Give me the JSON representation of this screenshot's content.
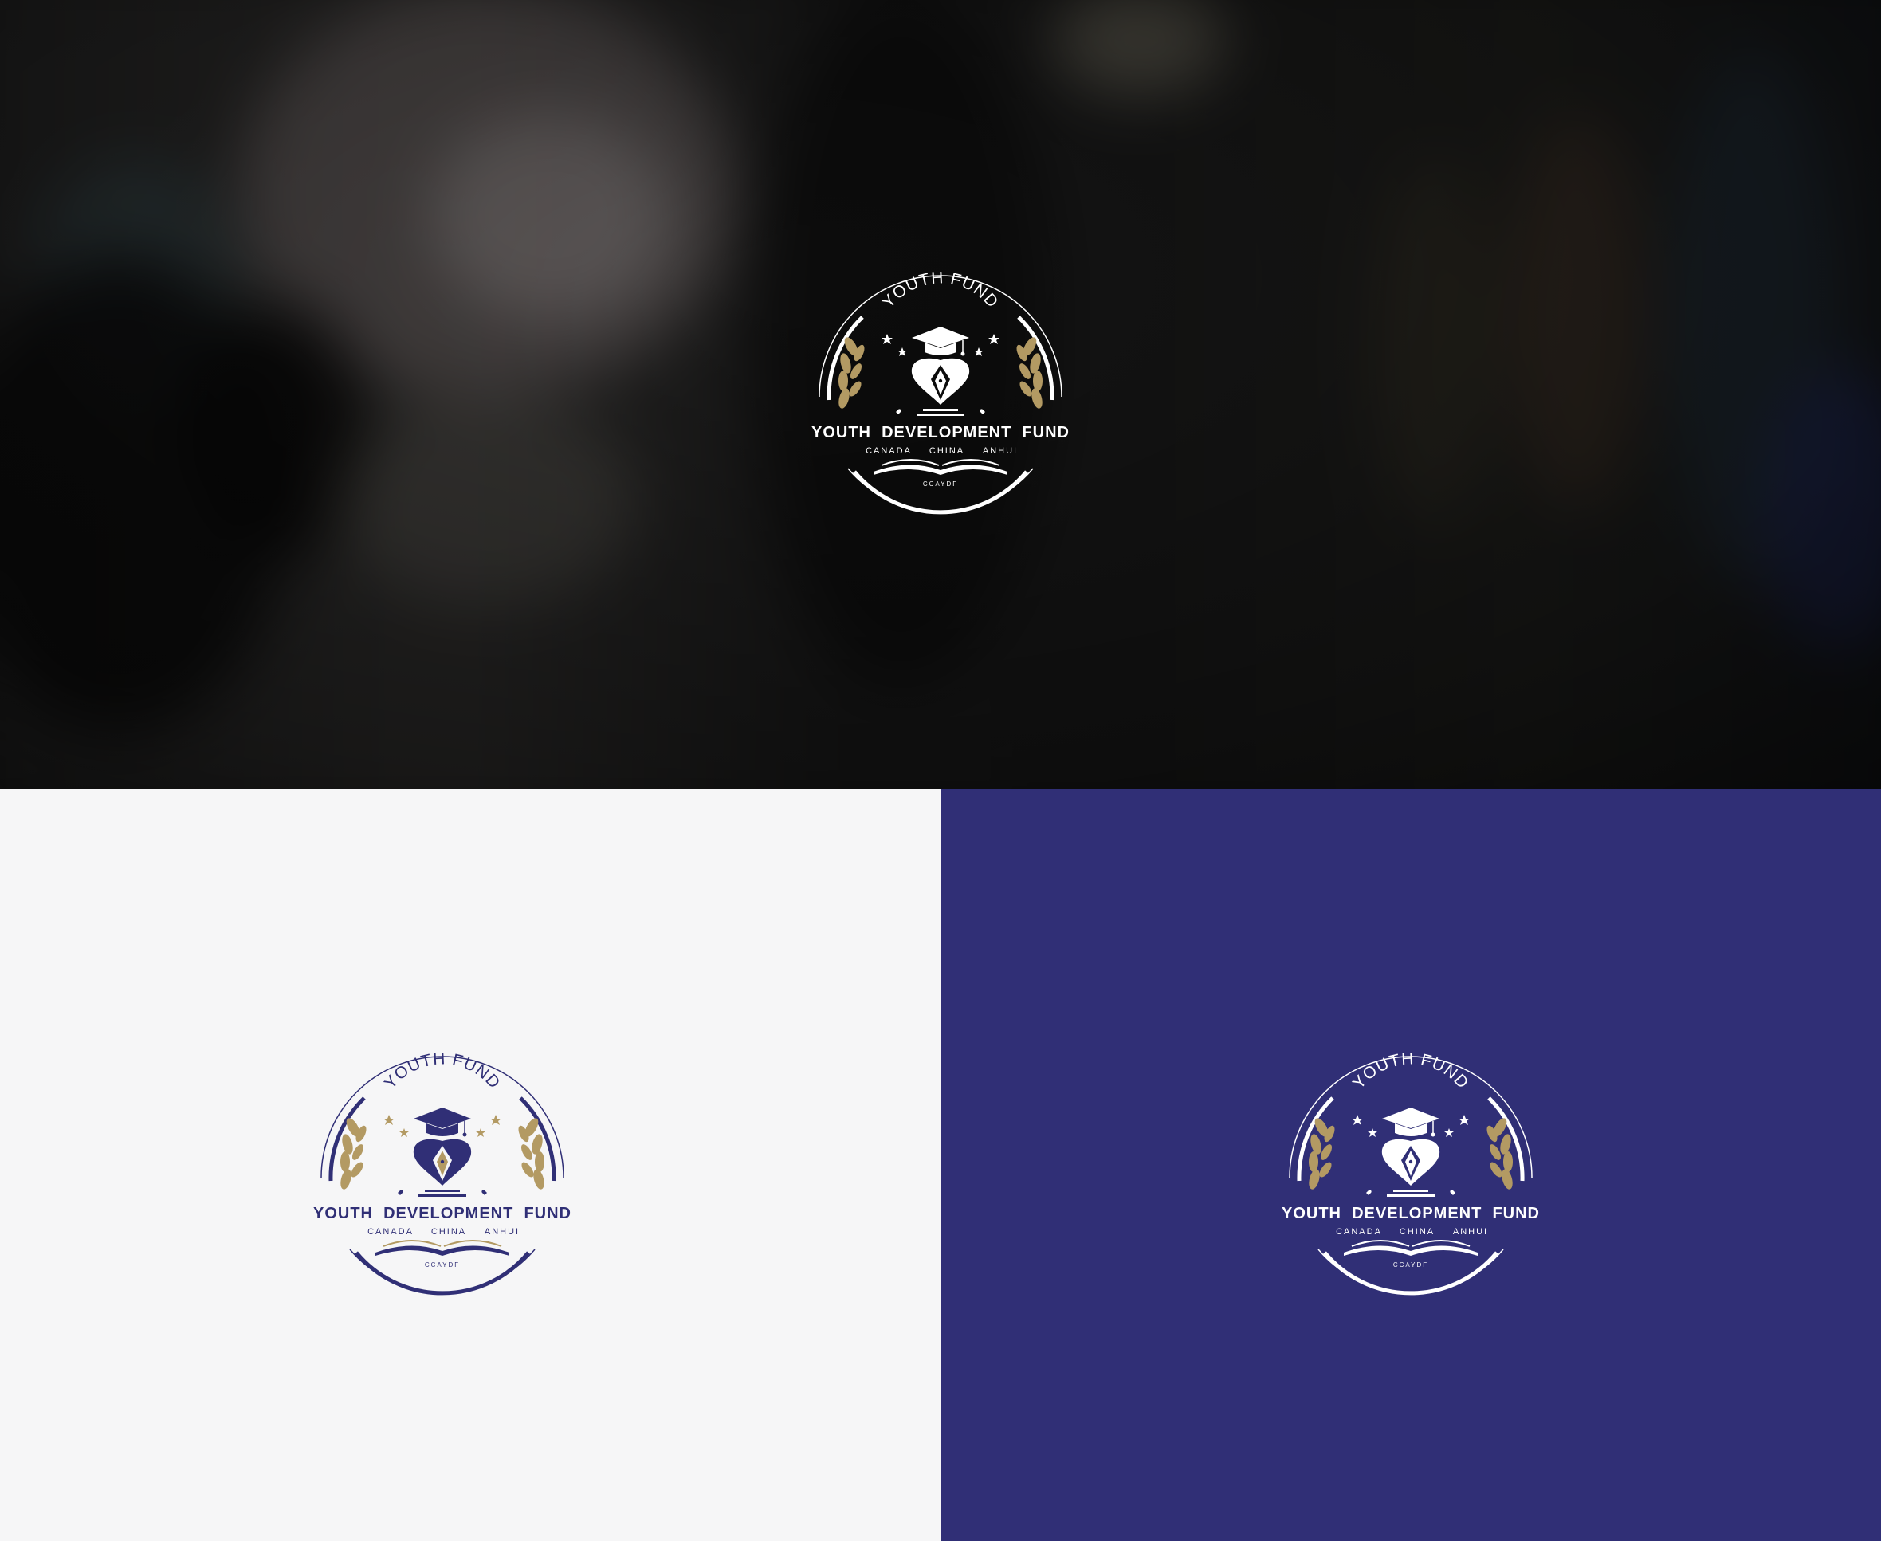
{
  "logo": {
    "arc_text": "YOUTH FUND",
    "main_text": "YOUTH  DEVELOPMENT  FUND",
    "locations": [
      "CANADA",
      "CHINA",
      "ANHUI"
    ],
    "abbreviation": "CCAYDF"
  },
  "colors": {
    "navy": "#302f76",
    "gold": "#b39a63",
    "light_bg": "#f6f6f7",
    "dark_bg": "#0c0c0c",
    "white": "#ffffff"
  },
  "panels": [
    {
      "id": "hero",
      "style": "white-on-photo"
    },
    {
      "id": "light",
      "style": "navy-on-light"
    },
    {
      "id": "navy",
      "style": "white-on-navy"
    }
  ]
}
